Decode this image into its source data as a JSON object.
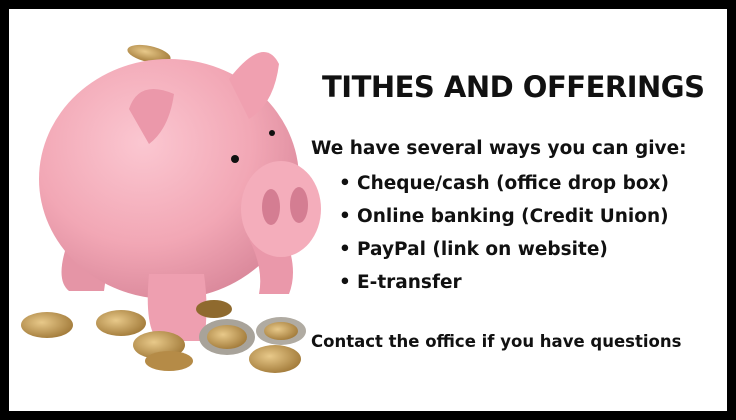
{
  "title": "TITHES AND OFFERINGS",
  "intro": "We have several ways you can give:",
  "methods": [
    "Cheque/cash (office drop box)",
    "Online banking (Credit Union)",
    "PayPal (link on website)",
    "E-transfer"
  ],
  "bullet": "•",
  "contact": "Contact the office if you have questions",
  "illustration": {
    "subject": "piggy-bank-with-coins",
    "pig_color": "#f2a7b5",
    "coin_color": "#c9a25a"
  }
}
